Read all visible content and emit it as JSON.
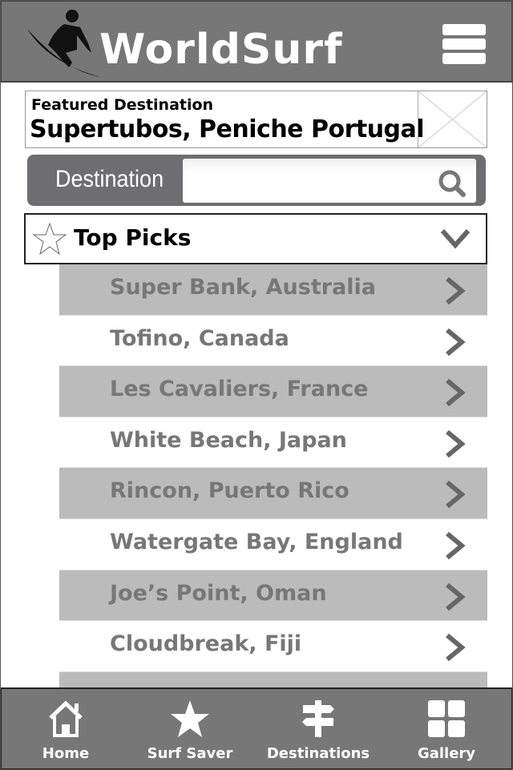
{
  "header": {
    "brand": "WorldSurf"
  },
  "featured": {
    "label": "Featured Destination",
    "name": "Supertubos, Peniche Portugal"
  },
  "search": {
    "label": "Destination",
    "value": "",
    "placeholder": ""
  },
  "top_picks": {
    "label": "Top Picks",
    "items": [
      {
        "label": "Super Bank, Australia"
      },
      {
        "label": "Tofino, Canada"
      },
      {
        "label": "Les Cavaliers, France"
      },
      {
        "label": "White Beach, Japan"
      },
      {
        "label": "Rincon, Puerto Rico"
      },
      {
        "label": "Watergate Bay, England"
      },
      {
        "label": "Joe’s Point, Oman"
      },
      {
        "label": "Cloudbreak, Fiji"
      },
      {
        "label": ""
      }
    ]
  },
  "nav": [
    {
      "label": "Home",
      "icon": "home-icon"
    },
    {
      "label": "Surf Saver",
      "icon": "star-icon"
    },
    {
      "label": "Destinations",
      "icon": "signpost-icon"
    },
    {
      "label": "Gallery",
      "icon": "grid-icon"
    }
  ],
  "colors": {
    "header": "#777777",
    "row_gray": "#bbbbbb",
    "text_gray": "#777777"
  }
}
